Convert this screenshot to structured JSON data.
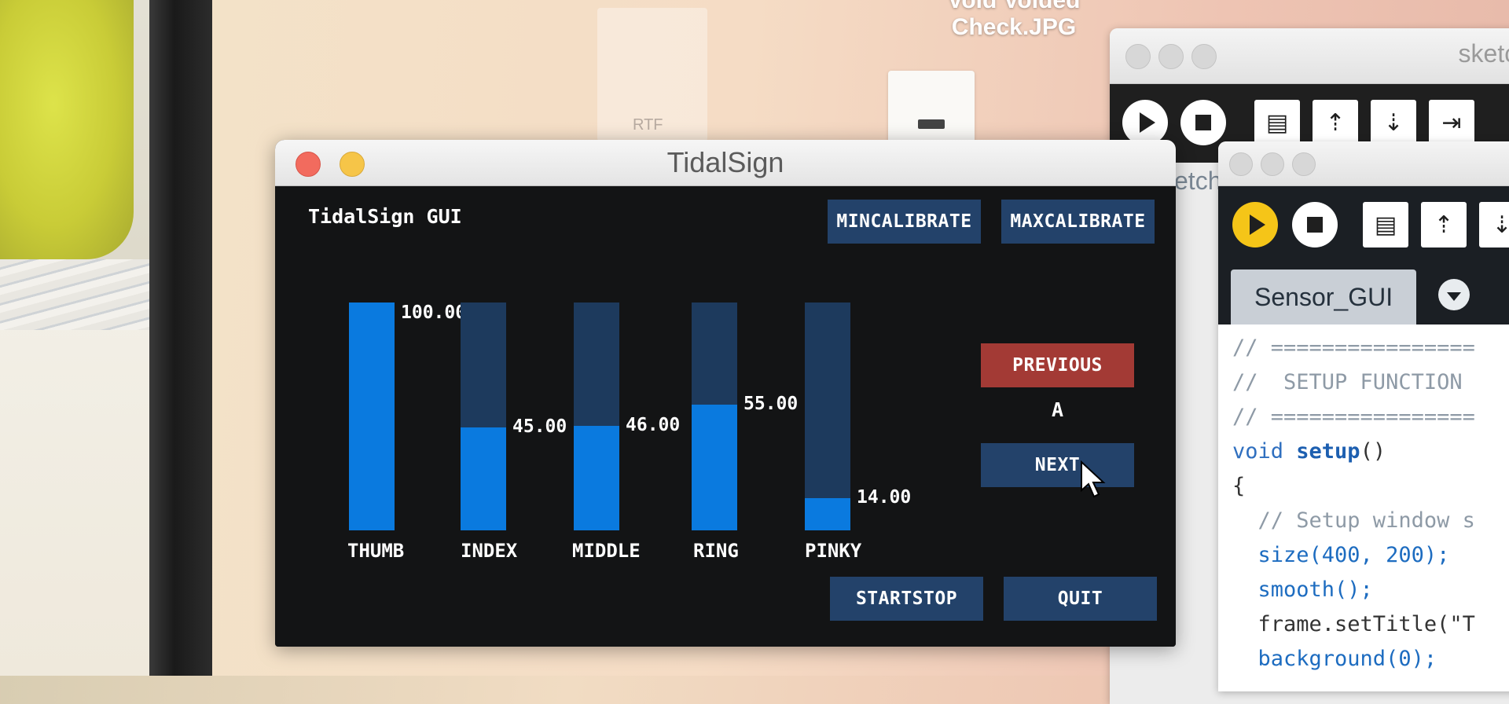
{
  "desktop": {
    "file_label_line1": "Void Voided",
    "file_label_line2": "Check.JPG",
    "ghost_label": "RTF"
  },
  "ide_back": {
    "title": "sketch",
    "partial_tab": "etch"
  },
  "ide_front": {
    "tab": "Sensor_GUI",
    "code_lines": [
      {
        "cls": "code-comment",
        "text": "// ================"
      },
      {
        "cls": "code-comment",
        "text": "//  SETUP FUNCTION"
      },
      {
        "cls": "code-comment",
        "text": "// ================"
      },
      {
        "cls": "mixed-void",
        "text": "void setup()"
      },
      {
        "cls": "plain",
        "text": "{"
      },
      {
        "cls": "code-comment",
        "text": "  // Setup window s"
      },
      {
        "cls": "call",
        "text": "  size(400, 200);"
      },
      {
        "cls": "call",
        "text": "  smooth();"
      },
      {
        "cls": "plain",
        "text": "  frame.setTitle(\"T"
      },
      {
        "cls": "call",
        "text": "  background(0);"
      }
    ]
  },
  "tidalsign": {
    "window_title": "TidalSign",
    "gui_label": "TidalSign GUI",
    "buttons": {
      "mincalibrate": "MINCALIBRATE",
      "maxcalibrate": "MAXCALIBRATE",
      "previous": "PREVIOUS",
      "next": "NEXT",
      "startstop": "STARTSTOP",
      "quit": "QUIT"
    },
    "current_letter": "A",
    "sliders": [
      {
        "name": "THUMB",
        "value": "100.00",
        "fraction": 1.0
      },
      {
        "name": "INDEX",
        "value": "45.00",
        "fraction": 0.45
      },
      {
        "name": "MIDDLE",
        "value": "46.00",
        "fraction": 0.46
      },
      {
        "name": "RING",
        "value": "55.00",
        "fraction": 0.55
      },
      {
        "name": "PINKY",
        "value": "14.00",
        "fraction": 0.14
      }
    ]
  },
  "colors": {
    "slider_track": "#1d3a5d",
    "slider_fill": "#0a7adf",
    "button": "#23426a",
    "button_active": "#a33a35"
  }
}
